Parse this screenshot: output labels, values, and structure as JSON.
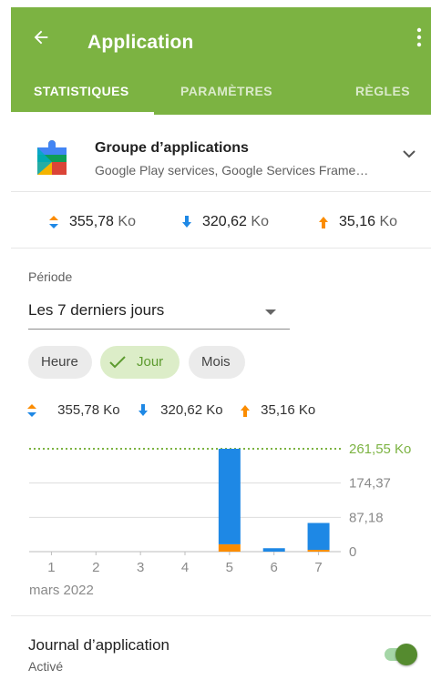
{
  "appbar": {
    "title": "Application",
    "tabs": [
      {
        "label": "STATISTIQUES",
        "active": true
      },
      {
        "label": "PARAMÈTRES",
        "active": false
      },
      {
        "label": "RÈGLES",
        "active": false
      }
    ]
  },
  "app_group": {
    "title": "Groupe d’applications",
    "subtitle": "Google Play services, Google Services Frame…"
  },
  "totals": {
    "total": "355,78",
    "download": "320,62",
    "upload": "35,16",
    "unit": "Ko"
  },
  "period": {
    "label": "Période",
    "selected": "Les 7 derniers jours"
  },
  "chips": [
    {
      "label": "Heure",
      "selected": false
    },
    {
      "label": "Jour",
      "selected": true
    },
    {
      "label": "Mois",
      "selected": false
    }
  ],
  "legend": {
    "total": "355,78 Ko",
    "download": "320,62 Ko",
    "upload": "35,16 Ko"
  },
  "chart_data": {
    "type": "bar",
    "stacked": true,
    "categories": [
      "1",
      "2",
      "3",
      "4",
      "5",
      "6",
      "7"
    ],
    "xlabel": "mars 2022",
    "series": [
      {
        "values": [
          0,
          0,
          0,
          0,
          18.7,
          0,
          4.5
        ],
        "color": "#fb8c00"
      },
      {
        "values": [
          0,
          0,
          0,
          0,
          242.85,
          8.7,
          68.4
        ],
        "color": "#1e88e5"
      }
    ],
    "ylim": [
      0,
      261.55
    ],
    "y_ticks": [
      "0",
      "87,18",
      "174,37"
    ],
    "max_label": "261,55 Ko",
    "max_line_color": "#7cb342",
    "grid": true
  },
  "journal": {
    "title": "Journal d’application",
    "status": "Activé",
    "enabled": true
  },
  "colors": {
    "accent": "#7cb342",
    "download": "#1e88e5",
    "upload": "#fb8c00"
  }
}
